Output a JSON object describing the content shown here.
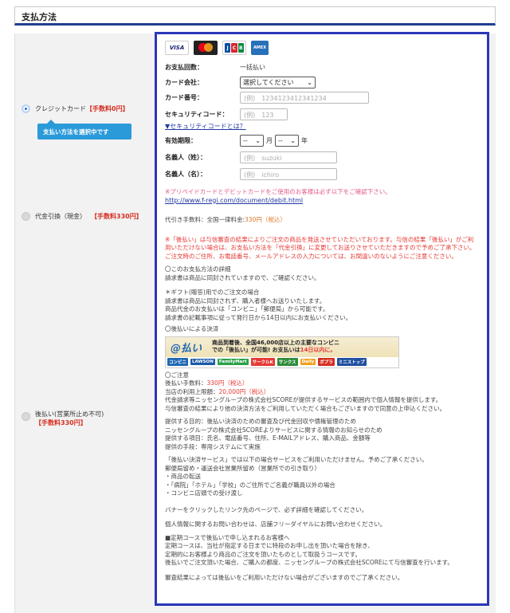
{
  "header": {
    "title": "支払方法"
  },
  "options": {
    "credit": {
      "label": "クレジットカード",
      "fee": "【手数料0円】",
      "tooltip": "支払い方法を選択中です"
    },
    "cod": {
      "label": "代金引換（現金）",
      "fee": "【手数料330円】"
    },
    "deferred": {
      "label": "後払い(営業所止め不可)",
      "fee": "【手数料330円】"
    }
  },
  "cards": [
    "VISA",
    "mastercard",
    "JCB",
    "AMERICAN EXPRESS"
  ],
  "form": {
    "installments_label": "お支払回数：",
    "installments_value": "一括払い",
    "card_company_label": "カード会社：",
    "card_company_value": "選択してください",
    "card_number_label": "カード番号：",
    "card_number_placeholder": "(例)　1234123412341234",
    "security_label": "セキュリティコード：",
    "security_placeholder": "(例)　123",
    "security_link": "▼セキュリティコードとは？",
    "expiry_label": "有効期限：",
    "expiry_month": "--",
    "month_unit": "月",
    "expiry_year": "--",
    "year_unit": "年",
    "last_name_label": "名義人（姓）：",
    "last_name_placeholder": "(例)　suzuki",
    "first_name_label": "名義人（名）：",
    "first_name_placeholder": "(例)　ichiro"
  },
  "notes": {
    "prepaid": "※プリペイドカードとデビットカードをご使用のお客様は必ず以下をご確認下さい。",
    "prepaid_link": "http://www.f-regi.com/document/debit.html",
    "cod_fee_prefix": "代引き手数料：全国一律料金:",
    "cod_fee_value": "330円（税込）",
    "deferred_warning": "※「後払い」は与信審査の結果によりご注文の商品を発送させていただいております。与信の結果「後払い」がご利用いただけない場合は、お支払い方法を「代金引換」に変更してお送りさせていただきますので予めご了承下さい。ご注文時のご住所、お電話番号、メールアドレスの入力については、お間違いのないようにご注意ください。",
    "detail_title": "〇このお支払方法の詳細",
    "detail_body": "請求書は商品に同封されていますので、ご確認ください。",
    "gift_title": "＊ギフト(贈答)用でのご注文の場合",
    "gift_lines": [
      "請求書は商品に同封されず、購入者様へお送りいたします。",
      "商品代金のお支払いは「コンビニ」「郵便局」から可能です。",
      "請求書の記載事項に従って発行日から14日以内にお支払いください。"
    ],
    "settlement_title": "〇後払いによる決済",
    "banner_logo": "@払い",
    "banner_line1": "商品到着後、全国46,000店以上の主要なコンビニ",
    "banner_line2a": "での「後払い」が可能! お支払いは",
    "banner_line2b": "14日以内に。",
    "banner_stores": [
      "コンビニ",
      "LAWSON",
      "FamilyMart",
      "サークルK",
      "サンクス",
      "Daily",
      "ポプラ",
      "ミニストップ"
    ],
    "caution_title": "〇ご注意",
    "fee_prefix": "後払い手数料：",
    "fee_value": "330円（税込）",
    "limit_prefix": "当店の利用上限額：",
    "limit_value": "20,000円（税込）",
    "score_lines": [
      "代金請求等ニッセングループの株式会社SCOREが提供するサービスの範囲内で個人情報を提供します。",
      "与信審査の結果により他の決済方法をご利用していただく場合もございますので同意の上申込ください。"
    ],
    "provide_lines": [
      "提供する目的：後払い決済のための審査及び代金回収や債権管理のため",
      "ニッセングループの株式会社SCOREよりサービスに関する情報のお知らせのため",
      "提供する項目：氏名、電話番号、住所、E-MAILアドレス、購入商品、金額等",
      "提供の手段：専用システムにて実施"
    ],
    "restrict_lines": [
      "「後払い決済サービス」では以下の場合サービスをご利用いただけません。予めご了承ください。",
      "郵便局留め・運送会社営業所留め（営業所での引き取り）",
      "・商品の転送",
      "・「病院」「ホテル」「学校」のご住所でご名義が職員以外の場合",
      "・コンビニ店頭での受け渡し"
    ],
    "banner_note": "バナーをクリックしたリンク先のページで、必ず詳細を確認してください。",
    "personal_info": "個人情報に関するお問い合わせは、店舗フリーダイヤルにお問い合わせください。",
    "regular_lines": [
      "■定期コースで後払いで申し込まれるお客様へ",
      "定期コースは、当社が指定する日までに特段のお申し出を頂いた場合を除き、",
      "定期的にお客様より商品のご注文を頂いたものとして取扱うコースです。",
      "後払いでご注文頂いた場合、ご購入の都度、ニッセングループの株式会社SCOREにて与信審査を行います。"
    ],
    "final": "審査結果によっては後払いをご利用いただけない場合がございますのでご了承ください。"
  }
}
